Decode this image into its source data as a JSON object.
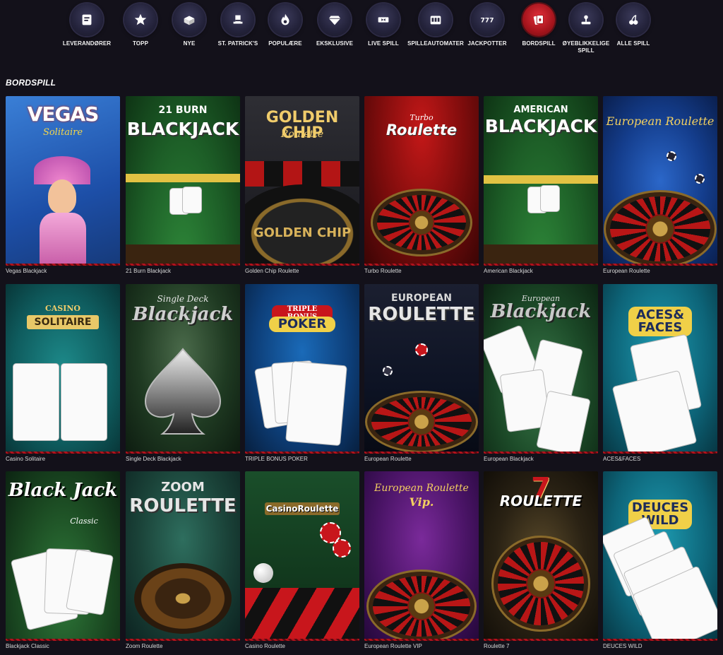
{
  "categories": [
    {
      "label": "LEVERANDØRER",
      "icon": "provider-book-icon",
      "active": false
    },
    {
      "label": "TOPP",
      "icon": "star-icon",
      "active": false
    },
    {
      "label": "NYE",
      "icon": "new-box-icon",
      "active": false
    },
    {
      "label": "ST. PATRICK'S",
      "icon": "leprechaun-hat-icon",
      "active": false
    },
    {
      "label": "POPULÆRE",
      "icon": "flame-icon",
      "active": false
    },
    {
      "label": "EKSKLUSIVE",
      "icon": "diamond-icon",
      "active": false
    },
    {
      "label": "LIVE SPILL",
      "icon": "live-ticket-icon",
      "active": false
    },
    {
      "label": "SPILLEAUTOMATER",
      "icon": "slot-machine-icon",
      "active": false
    },
    {
      "label": "JACKPOTTER",
      "icon": "jackpot-777-icon",
      "active": false
    },
    {
      "label": "BORDSPILL",
      "icon": "playing-cards-icon",
      "active": true
    },
    {
      "label": "ØYEBLIKKELIGE SPILL",
      "icon": "instant-game-icon",
      "active": false
    },
    {
      "label": "ALLE SPILL",
      "icon": "cherries-icon",
      "active": false
    }
  ],
  "section_title": "BORDSPILL",
  "games": [
    {
      "name": "Vegas Blackjack",
      "art": {
        "title": "VEGAS",
        "sub": "Solitaire"
      }
    },
    {
      "name": "21 Burn Blackjack",
      "art": {
        "title": "BLACKJACK",
        "sub": "21 BURN"
      }
    },
    {
      "name": "Golden Chip Roulette",
      "art": {
        "title": "GOLDEN CHIP",
        "sub": "Roulette"
      }
    },
    {
      "name": "Turbo Roulette",
      "art": {
        "title": "Roulette",
        "sub": "Turbo"
      }
    },
    {
      "name": "American Blackjack",
      "art": {
        "title": "BLACKJACK",
        "sub": "AMERICAN"
      }
    },
    {
      "name": "European Roulette",
      "art": {
        "title": "",
        "sub": "European Roulette"
      }
    },
    {
      "name": "Casino Solitaire",
      "art": {
        "title": "SOLITAIRE",
        "sub": "CASINO"
      }
    },
    {
      "name": "Single Deck Blackjack",
      "art": {
        "title": "Blackjack",
        "sub": "Single Deck"
      }
    },
    {
      "name": "TRIPLE BONUS POKER",
      "art": {
        "title": "POKER",
        "sub": "TRIPLE BONUS"
      }
    },
    {
      "name": "European Roulette",
      "art": {
        "title": "ROULETTE",
        "sub": "EUROPEAN"
      }
    },
    {
      "name": "European Blackjack",
      "art": {
        "title": "Blackjack",
        "sub": "European"
      }
    },
    {
      "name": "ACES&FACES",
      "art": {
        "title": "ACES& FACES",
        "sub": ""
      }
    },
    {
      "name": "Blackjack Classic",
      "art": {
        "title": "Black Jack",
        "sub": "Classic"
      }
    },
    {
      "name": "Zoom Roulette",
      "art": {
        "title": "ROULETTE",
        "sub": "ZOOM"
      }
    },
    {
      "name": "Casino Roulette",
      "art": {
        "title": "CasinoRoulette",
        "sub": ""
      }
    },
    {
      "name": "European Roulette VIP",
      "art": {
        "title": "Vip.",
        "sub": "European Roulette"
      }
    },
    {
      "name": "Roulette 7",
      "art": {
        "title": "ROULETTE",
        "sub": "7"
      }
    },
    {
      "name": "DEUCES WILD",
      "art": {
        "title": "DEUCES WILD",
        "sub": ""
      }
    }
  ]
}
